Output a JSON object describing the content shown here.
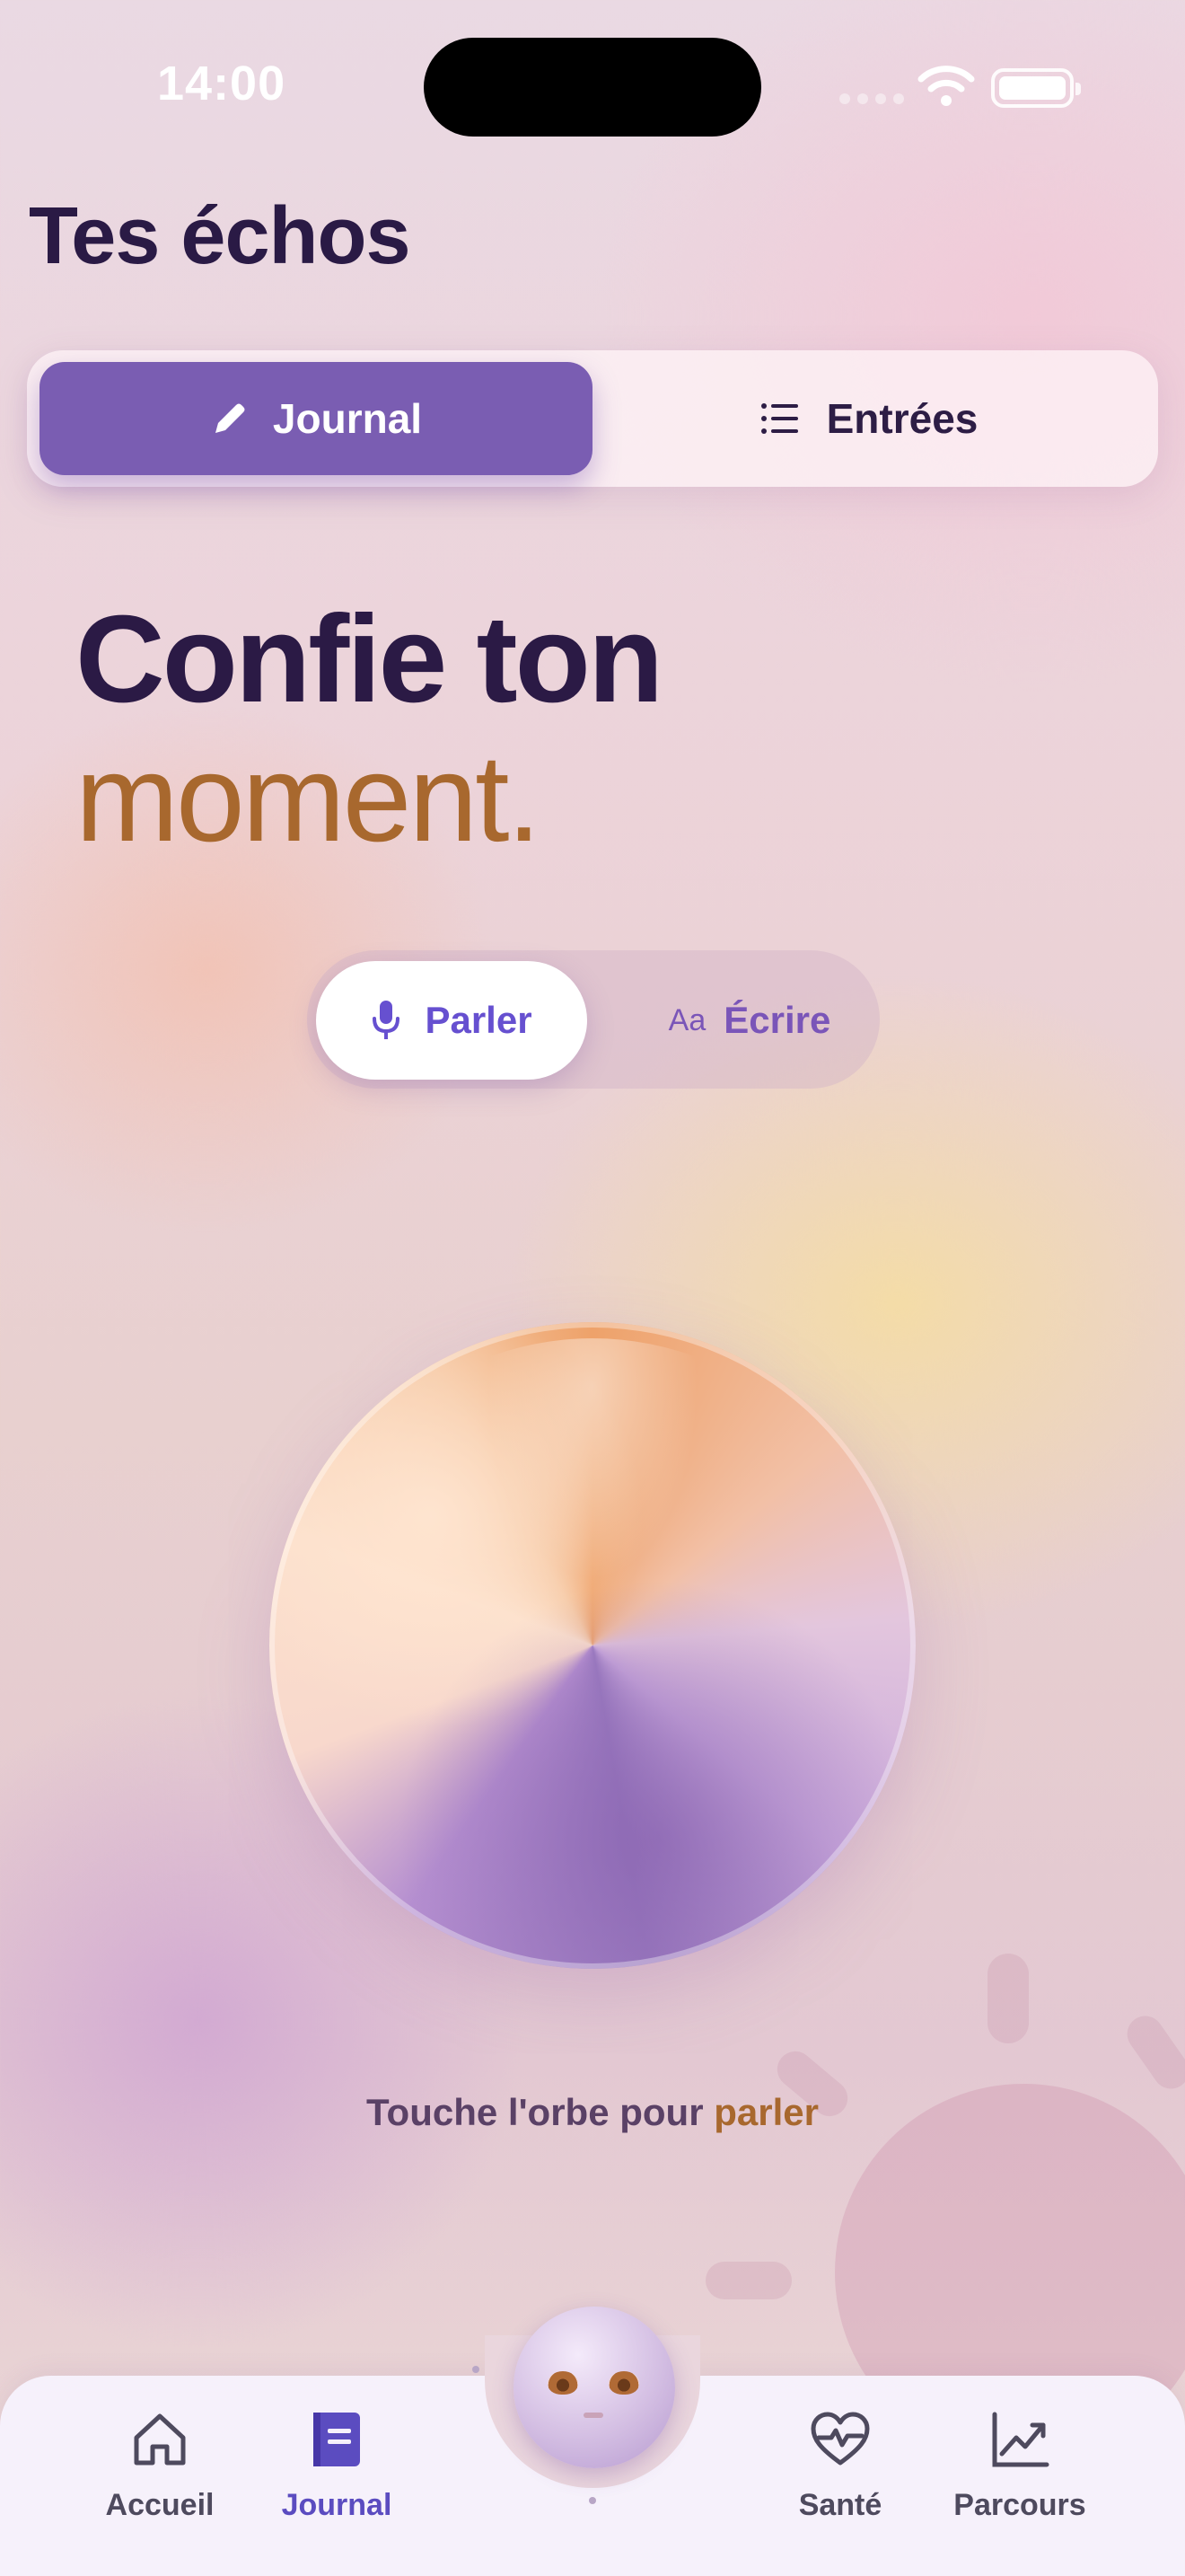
{
  "status_bar": {
    "time": "14:00"
  },
  "header": {
    "title": "Tes échos"
  },
  "segment_tabs": [
    {
      "label": "Journal",
      "icon": "pencil-icon",
      "active": true
    },
    {
      "label": "Entrées",
      "icon": "list-icon",
      "active": false
    }
  ],
  "headline": {
    "line1": "Confie ton",
    "line2": "moment."
  },
  "mode_toggle": {
    "talk_label": "Parler",
    "write_icon_text": "Aa",
    "write_label": "Écrire",
    "selected": "Parler"
  },
  "orb": {
    "icon": "voice-orb"
  },
  "hint": {
    "prefix": "Touche l'orbe pour ",
    "accent": "parler"
  },
  "bottom_nav": [
    {
      "label": "Accueil",
      "icon": "home-icon",
      "active": false
    },
    {
      "label": "Journal",
      "icon": "journal-icon",
      "active": true
    },
    {
      "label": "Santé",
      "icon": "heart-pulse-icon",
      "active": false
    },
    {
      "label": "Parcours",
      "icon": "chart-line-icon",
      "active": false
    }
  ],
  "colors": {
    "accent_purple": "#7a5db2",
    "accent_orange": "#a8682e",
    "title_dark": "#2b1a45",
    "nav_active": "#5b4cc0"
  }
}
